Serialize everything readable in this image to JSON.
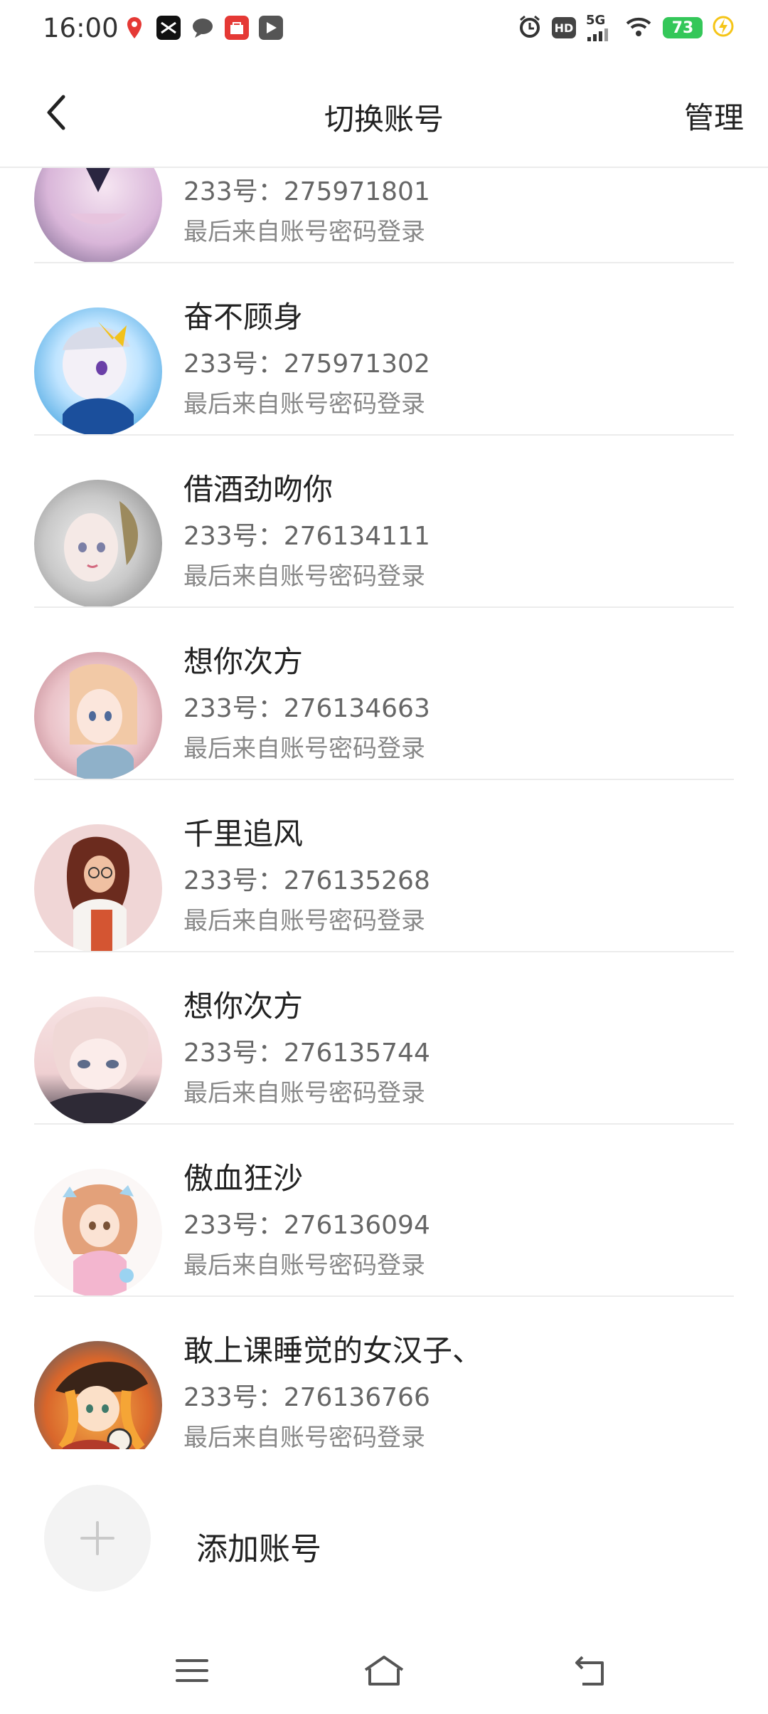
{
  "status_bar": {
    "time": "16:00",
    "network": "5G",
    "hd": "HD",
    "battery": "73",
    "icons": [
      "location-icon",
      "capcut-icon",
      "message-icon",
      "shop-icon",
      "video-icon",
      "alarm-icon",
      "hd-icon",
      "signal-icon",
      "wifi-icon",
      "battery-icon",
      "charging-icon"
    ]
  },
  "nav": {
    "title": "切换账号",
    "manage_label": "管理",
    "back_icon": "chevron-left-icon"
  },
  "accounts": [
    {
      "name": "",
      "id": "233号：275971801",
      "login": "最后来自账号密码登录"
    },
    {
      "name": "奋不顾身",
      "id": "233号：275971302",
      "login": "最后来自账号密码登录"
    },
    {
      "name": "借酒劲吻你",
      "id": "233号：276134111",
      "login": "最后来自账号密码登录"
    },
    {
      "name": "想你次方",
      "id": "233号：276134663",
      "login": "最后来自账号密码登录"
    },
    {
      "name": "千里追风",
      "id": "233号：276135268",
      "login": "最后来自账号密码登录"
    },
    {
      "name": "想你次方",
      "id": "233号：276135744",
      "login": "最后来自账号密码登录"
    },
    {
      "name": "傲血狂沙",
      "id": "233号：276136094",
      "login": "最后来自账号密码登录"
    },
    {
      "name": "敢上课睡觉的女汉子、",
      "id": "233号：276136766",
      "login": "最后来自账号密码登录"
    }
  ],
  "add_account": {
    "label": "添加账号",
    "icon": "plus-icon"
  },
  "bottom_nav": {
    "icons": [
      "menu-icon",
      "home-icon",
      "back-icon"
    ]
  },
  "colors": {
    "divider": "#ececec",
    "text_primary": "#222222",
    "text_secondary": "#666666",
    "text_tertiary": "#888888",
    "battery": "#34c759"
  }
}
